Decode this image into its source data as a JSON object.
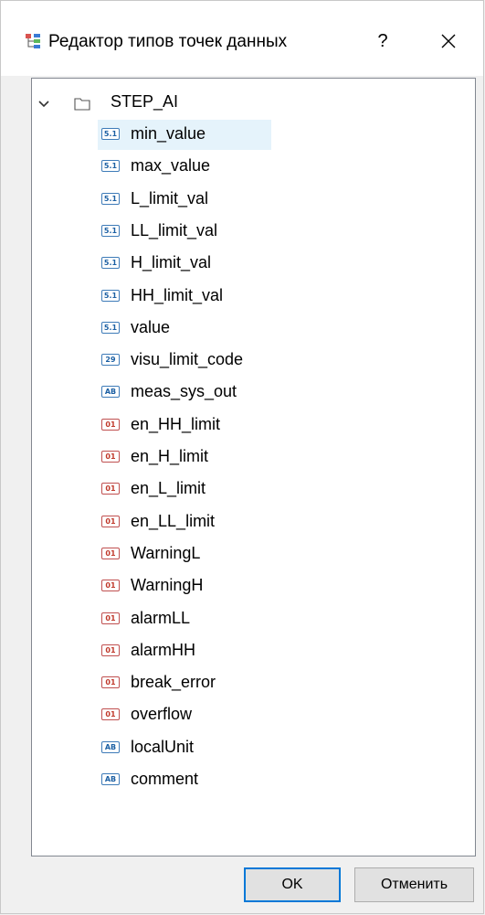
{
  "window": {
    "title": "Редактор типов точек данных",
    "help_label": "?"
  },
  "tree": {
    "root_label": "STEP_AI",
    "items": [
      {
        "label": "min_value",
        "badge": "5.1",
        "type": "float",
        "selected": true
      },
      {
        "label": "max_value",
        "badge": "5.1",
        "type": "float"
      },
      {
        "label": "L_limit_val",
        "badge": "5.1",
        "type": "float"
      },
      {
        "label": "LL_limit_val",
        "badge": "5.1",
        "type": "float"
      },
      {
        "label": "H_limit_val",
        "badge": "5.1",
        "type": "float"
      },
      {
        "label": "HH_limit_val",
        "badge": "5.1",
        "type": "float"
      },
      {
        "label": "value",
        "badge": "5.1",
        "type": "float"
      },
      {
        "label": "visu_limit_code",
        "badge": "29",
        "type": "int"
      },
      {
        "label": "meas_sys_out",
        "badge": "AB",
        "type": "str"
      },
      {
        "label": "en_HH_limit",
        "badge": "01",
        "type": "bool"
      },
      {
        "label": "en_H_limit",
        "badge": "01",
        "type": "bool"
      },
      {
        "label": "en_L_limit",
        "badge": "01",
        "type": "bool"
      },
      {
        "label": "en_LL_limit",
        "badge": "01",
        "type": "bool"
      },
      {
        "label": "WarningL",
        "badge": "01",
        "type": "bool"
      },
      {
        "label": "WarningH",
        "badge": "01",
        "type": "bool"
      },
      {
        "label": "alarmLL",
        "badge": "01",
        "type": "bool"
      },
      {
        "label": "alarmHH",
        "badge": "01",
        "type": "bool"
      },
      {
        "label": "break_error",
        "badge": "01",
        "type": "bool"
      },
      {
        "label": "overflow",
        "badge": "01",
        "type": "bool"
      },
      {
        "label": "localUnit",
        "badge": "AB",
        "type": "str"
      },
      {
        "label": "comment",
        "badge": "AB",
        "type": "str"
      }
    ]
  },
  "buttons": {
    "ok_label": "OK",
    "cancel_label": "Отменить"
  },
  "colors": {
    "selection": "#e5f3fb",
    "ok_border": "#0078d7",
    "bool_badge": "#c0392b",
    "value_badge": "#1b5fa3"
  },
  "icons": {
    "app": "type-tree-icon",
    "close": "close-icon",
    "expander": "chevron-down-icon",
    "folder": "folder-icon"
  }
}
